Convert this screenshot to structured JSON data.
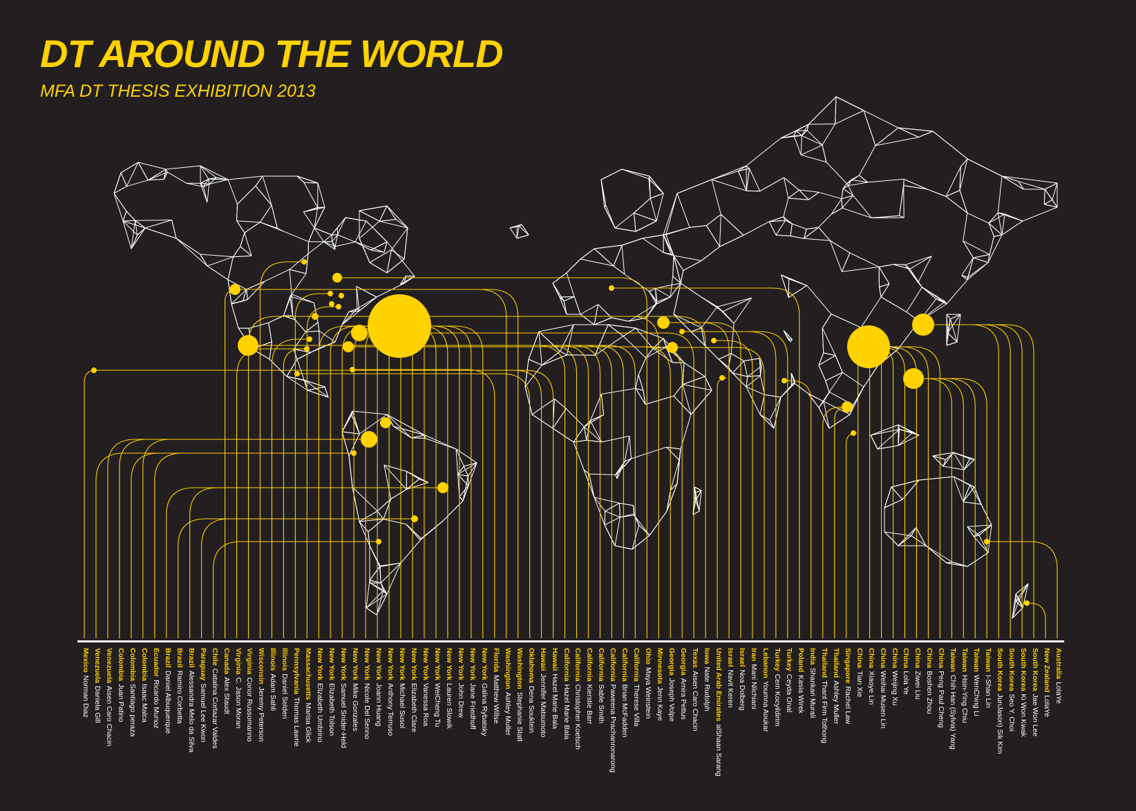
{
  "header": {
    "title": "DT AROUND THE WORLD",
    "subtitle": "MFA DT THESIS EXHIBITION 2013"
  },
  "colors": {
    "background": "#231f20",
    "accent": "#ffd200",
    "lines": "#ffffff"
  },
  "students": [
    {
      "country": "Mexico",
      "name": "Norman Diaz"
    },
    {
      "country": "Venezuela",
      "name": "Daniela Gill"
    },
    {
      "country": "Venezuela",
      "name": "Aisen Caro Chacin"
    },
    {
      "country": "Colombia",
      "name": "Juan Patino"
    },
    {
      "country": "Colombia",
      "name": "Santiago peraza"
    },
    {
      "country": "Colombia",
      "name": "Isaac Malca"
    },
    {
      "country": "Ecuador",
      "name": "Ricardo Munoz"
    },
    {
      "country": "Brazil",
      "name": "Daniel Albuquerque"
    },
    {
      "country": "Brazil",
      "name": "Ramiro Corbetta"
    },
    {
      "country": "Brazil",
      "name": "Alessandra Melo da Silva"
    },
    {
      "country": "Paraguay",
      "name": "Samuel Lee Kwon"
    },
    {
      "country": "Chile",
      "name": "Catalina Cortazar Valdes"
    },
    {
      "country": "Canada",
      "name": "Alex Staudt"
    },
    {
      "country": "Virginia",
      "name": "C. Jason Moran"
    },
    {
      "country": "Virginia",
      "name": "Conor Russomanno"
    },
    {
      "country": "Wisconsin",
      "name": "Jeremy Peterson"
    },
    {
      "country": "Illinois",
      "name": "Adam Sahli"
    },
    {
      "country": "Illinois",
      "name": "Daniel Selden"
    },
    {
      "country": "Pennsylvania",
      "name": "Thomas Lawrie"
    },
    {
      "country": "Massachusetts",
      "name": "Marisa Glick"
    },
    {
      "country": "New York",
      "name": "Elizabeth Umbrino"
    },
    {
      "country": "New York",
      "name": "Elizabeth Tolson"
    },
    {
      "country": "New York",
      "name": "Samuel Snider-Held"
    },
    {
      "country": "New York",
      "name": "Mike Gonzales"
    },
    {
      "country": "New York",
      "name": "Nicole Del Senno"
    },
    {
      "country": "New York",
      "name": "Joann Huang"
    },
    {
      "country": "New York",
      "name": "Anthony Terruso"
    },
    {
      "country": "New York",
      "name": "Michael Susol"
    },
    {
      "country": "New York",
      "name": "Elizabeth Clare"
    },
    {
      "country": "New York",
      "name": "Vanessa Roa"
    },
    {
      "country": "New York",
      "name": "WeiCheng Tu"
    },
    {
      "country": "New York",
      "name": "Lauren Slowik"
    },
    {
      "country": "New York",
      "name": "John Drew"
    },
    {
      "country": "New York",
      "name": "Jane Friedhoff"
    },
    {
      "country": "New York",
      "name": "Galina Rybatsky"
    },
    {
      "country": "Florida",
      "name": "Matthew Willse"
    },
    {
      "country": "Washington",
      "name": "Ashley Muller"
    },
    {
      "country": "Washington",
      "name": "Stephanie Statt"
    },
    {
      "country": "Oklahoma",
      "name": "Dena Souklein"
    },
    {
      "country": "Hawaii",
      "name": "Jennifer Matsumoto"
    },
    {
      "country": "Hawaii",
      "name": "Hazel Marie Bala"
    },
    {
      "country": "California",
      "name": "Hazel Marie Bala"
    },
    {
      "country": "California",
      "name": "Christopher Koelsch"
    },
    {
      "country": "California",
      "name": "Kierstie Barr"
    },
    {
      "country": "California",
      "name": "Sable Smith"
    },
    {
      "country": "California",
      "name": "Paweena Prachanronarong"
    },
    {
      "country": "California",
      "name": "Brian McFadden"
    },
    {
      "country": "California",
      "name": "Therese Villa"
    },
    {
      "country": "Ohio",
      "name": "Maya Weinstein"
    },
    {
      "country": "Minnesota",
      "name": "Jenn Kaye"
    },
    {
      "country": "Georgia",
      "name": "Joseph Volpe"
    },
    {
      "country": "Georgia",
      "name": "Amira Pettus"
    },
    {
      "country": "Texas",
      "name": "Aisen Caro Chacin"
    },
    {
      "country": "Iowa",
      "name": "Nate Rudolph"
    },
    {
      "country": "United Arab Emirates",
      "name": "alShaan Sarang"
    },
    {
      "country": "Israel",
      "name": "Navit Keren"
    },
    {
      "country": "Israel",
      "name": "Noa Dolberg"
    },
    {
      "country": "Iran",
      "name": "Mani Nilchiani"
    },
    {
      "country": "Lebanon",
      "name": "Youmna Aoukar"
    },
    {
      "country": "Turkey",
      "name": "Cem Kocyildirim"
    },
    {
      "country": "Turkey",
      "name": "Ceyda Onal"
    },
    {
      "country": "Poland",
      "name": "Kasia Wirek"
    },
    {
      "country": "India",
      "name": "Shankari Murali"
    },
    {
      "country": "Thailand",
      "name": "Thant Firm Tothong"
    },
    {
      "country": "Thailand",
      "name": "Ashley Muller"
    },
    {
      "country": "Singapore",
      "name": "Rachel Law"
    },
    {
      "country": "China",
      "name": "Tian Xie"
    },
    {
      "country": "China",
      "name": "Xiaoye Lin"
    },
    {
      "country": "China",
      "name": "Weihai Musen Lin"
    },
    {
      "country": "China",
      "name": "Weijing Xu"
    },
    {
      "country": "China",
      "name": "Lola Ye"
    },
    {
      "country": "China",
      "name": "Ziwei Liu"
    },
    {
      "country": "China",
      "name": "Boshen Zhou"
    },
    {
      "country": "China",
      "name": "Peng Paul Cheng"
    },
    {
      "country": "Taiwan",
      "name": "Chih Han (Sylvia) Yang"
    },
    {
      "country": "Taiwan",
      "name": "Hsin-Ying Chiu"
    },
    {
      "country": "Taiwan",
      "name": "WenChing Li"
    },
    {
      "country": "Taiwan",
      "name": "I-Shan Lin"
    },
    {
      "country": "South Korea",
      "name": "JunJason) Sik Kim"
    },
    {
      "country": "South Korea",
      "name": "Seo Y. Choi"
    },
    {
      "country": "South Korea",
      "name": "Ki Won Kwak"
    },
    {
      "country": "South Korea",
      "name": "Jae Won Lee"
    },
    {
      "country": "New Zealand",
      "name": "LolaYe"
    },
    {
      "country": "Australia",
      "name": "LolaYe"
    }
  ]
}
